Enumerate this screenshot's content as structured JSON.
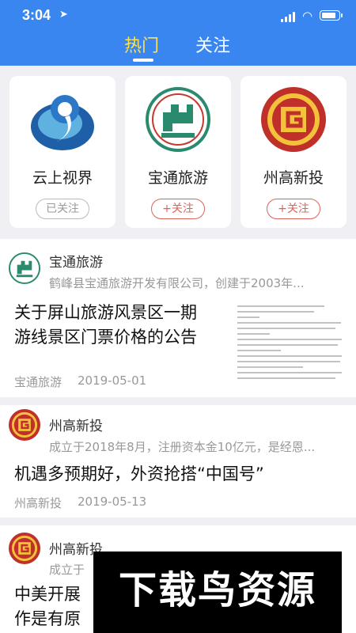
{
  "status_bar": {
    "time": "3:04"
  },
  "tabs": [
    {
      "label": "热门",
      "active": true
    },
    {
      "label": "关注",
      "active": false
    }
  ],
  "colors": {
    "header": "#3a86f0",
    "active_tab": "#ffe14d",
    "follow_red": "#d9655a"
  },
  "featured": [
    {
      "name": "云上视界",
      "button": "已关注",
      "icon": "yunshang-logo-icon"
    },
    {
      "name": "宝通旅游",
      "button": "+关注",
      "icon": "baotong-logo-icon"
    },
    {
      "name": "州高新投",
      "button": "+关注",
      "icon": "zhougao-logo-icon"
    }
  ],
  "posts": [
    {
      "source": "宝通旅游",
      "description": "鹤峰县宝通旅游开发有限公司，创建于2003年...",
      "title_lines": [
        "关于屏山旅游风景区一期",
        "游线景区门票价格的公告"
      ],
      "meta_source": "宝通旅游",
      "date": "2019-05-01"
    },
    {
      "source": "州高新投",
      "description": "成立于2018年8月，注册资本金10亿元，是经恩...",
      "title": "机遇多预期好，外资抢搭“中国号”",
      "meta_source": "州高新投",
      "date": "2019-05-13"
    },
    {
      "source": "州高新投",
      "description": "成立于",
      "title_lines": [
        "中美开展",
        "作是有原"
      ]
    }
  ],
  "watermark": "下载鸟资源"
}
